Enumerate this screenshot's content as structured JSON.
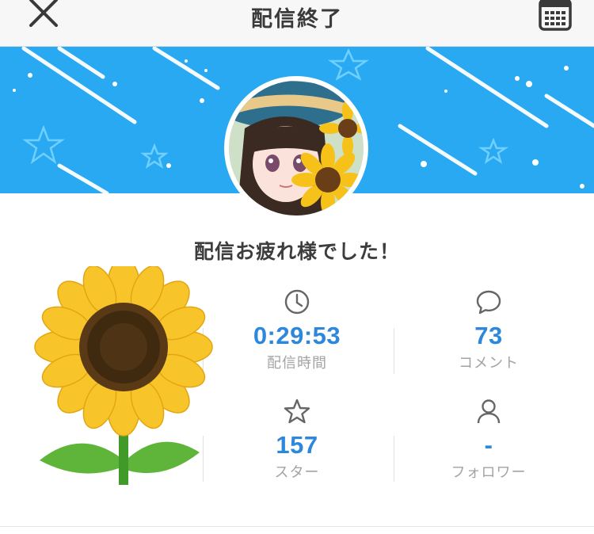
{
  "header": {
    "title": "配信終了",
    "close_icon": "close-icon",
    "calendar_icon": "calendar-icon"
  },
  "banner": {
    "background": "#29a9f1"
  },
  "message": "配信お疲れ様でした！",
  "stats": {
    "duration": {
      "value": "0:29:53",
      "label": "配信時間",
      "icon": "clock-icon"
    },
    "comments": {
      "value": "73",
      "label": "コメント",
      "icon": "comment-icon"
    },
    "stars": {
      "value": "157",
      "label": "スター",
      "icon": "star-icon"
    },
    "followers": {
      "value": "-",
      "label": "フォロワー",
      "icon": "user-icon"
    }
  },
  "colors": {
    "accent": "#2d88db",
    "label": "#a3a3a3"
  }
}
